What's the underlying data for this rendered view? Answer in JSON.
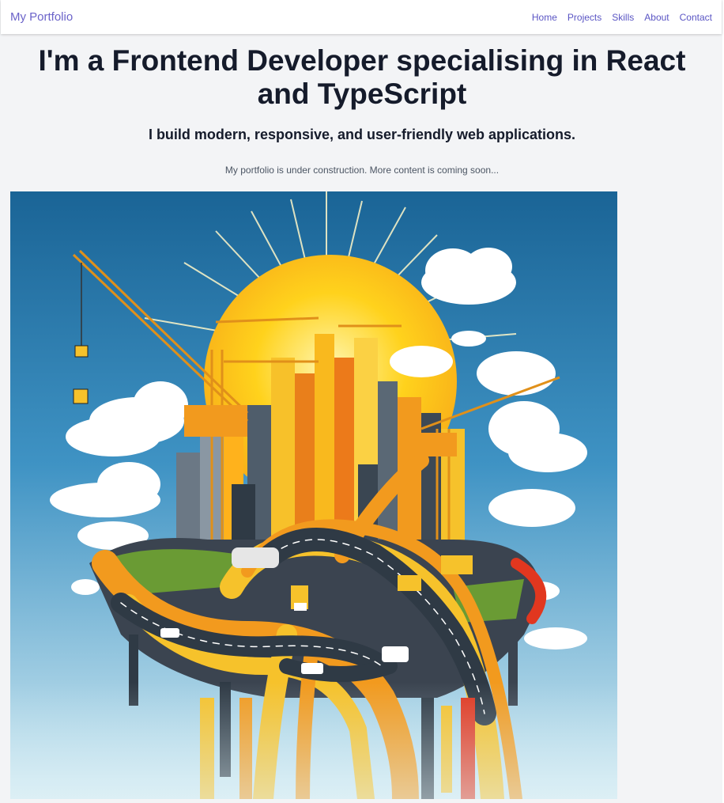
{
  "nav": {
    "brand": "My Portfolio",
    "links": [
      "Home",
      "Projects",
      "Skills",
      "About",
      "Contact"
    ]
  },
  "hero": {
    "title_line1": "I'm a Frontend Developer specialising in React",
    "title_line2": "and TypeScript",
    "subtitle": "I build modern, responsive, and user-friendly web applications.",
    "notice": "My portfolio is under construction. More content is coming soon..."
  },
  "image": {
    "description_icon": "city-under-construction-illustration"
  },
  "colors": {
    "accent": "#5a55c4",
    "heading": "#151b2b",
    "background": "#f3f4f6",
    "sky_top": "#1f6fa2",
    "sky_bottom": "#cfe8f1",
    "sun": "#ffcf1f",
    "road_orange": "#f29a1e",
    "road_yellow": "#f6c22b",
    "asphalt": "#2f3a45"
  }
}
